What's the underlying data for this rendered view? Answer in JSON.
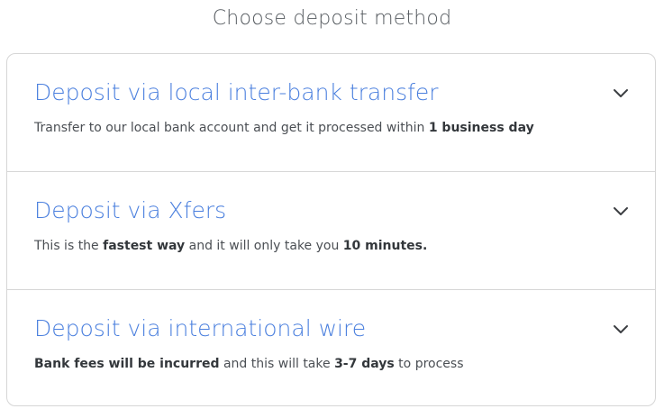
{
  "page": {
    "title": "Choose deposit method"
  },
  "options": [
    {
      "title": "Deposit via local inter-bank transfer",
      "desc_parts": [
        {
          "text": "Transfer to our local bank account and get it processed within ",
          "bold": false
        },
        {
          "text": "1 business day",
          "bold": true
        }
      ],
      "icon": "chevron-down-icon"
    },
    {
      "title": "Deposit via Xfers",
      "desc_parts": [
        {
          "text": "This is the ",
          "bold": false
        },
        {
          "text": "fastest way",
          "bold": true
        },
        {
          "text": " and it will only take you ",
          "bold": false
        },
        {
          "text": "10 minutes.",
          "bold": true
        }
      ],
      "icon": "chevron-down-icon"
    },
    {
      "title": "Deposit via international wire",
      "desc_parts": [
        {
          "text": "Bank fees will be incurred",
          "bold": true
        },
        {
          "text": " and this will take ",
          "bold": false
        },
        {
          "text": "3-7 days",
          "bold": true
        },
        {
          "text": " to process",
          "bold": false
        }
      ],
      "icon": "chevron-down-icon"
    }
  ],
  "colors": {
    "accent": "#4a7fde",
    "text": "#4b4f54",
    "border": "#d6d6d6"
  }
}
